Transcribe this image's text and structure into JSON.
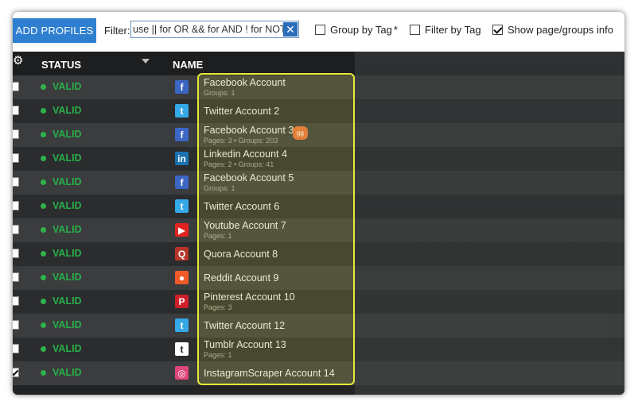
{
  "toolbar": {
    "add_profiles_label": "ADD PROFILES",
    "filter_label": "Filter:",
    "filter_value": "use || for OR && for AND ! for NOT",
    "filter_clear_glyph": "✕",
    "group_by_tag_label": "Group by Tag",
    "group_by_tag_asterisk": "*",
    "group_by_tag_checked": false,
    "filter_by_tag_label": "Filter by Tag",
    "filter_by_tag_checked": false,
    "show_info_label": "Show page/groups info",
    "show_info_checked": true
  },
  "table": {
    "gear_glyph": "⚙",
    "header_status": "STATUS",
    "header_name": "NAME",
    "rows": [
      {
        "status": "VALID",
        "icon": "facebook-icon",
        "icon_glyph": "f",
        "icon_color": "#3b66c4",
        "name": "Facebook Account",
        "sub": "Groups: 1",
        "checked": false
      },
      {
        "status": "VALID",
        "icon": "twitter-icon",
        "icon_glyph": "t",
        "icon_color": "#35a8e8",
        "name": "Twitter Account 2",
        "sub": "",
        "checked": false
      },
      {
        "status": "VALID",
        "icon": "facebook-icon",
        "icon_glyph": "f",
        "icon_color": "#3b66c4",
        "name": "Facebook Account 3",
        "sub": "Pages: 3 • Groups: 203",
        "badge": "gg",
        "checked": false
      },
      {
        "status": "VALID",
        "icon": "linkedin-icon",
        "icon_glyph": "in",
        "icon_color": "#1a73b1",
        "name": "Linkedin Account 4",
        "sub": "Pages: 2 • Groups: 41",
        "checked": false
      },
      {
        "status": "VALID",
        "icon": "facebook-icon",
        "icon_glyph": "f",
        "icon_color": "#3b66c4",
        "name": "Facebook Account 5",
        "sub": "Groups: 1",
        "checked": false
      },
      {
        "status": "VALID",
        "icon": "twitter-icon",
        "icon_glyph": "t",
        "icon_color": "#35a8e8",
        "name": "Twitter Account  6",
        "sub": "",
        "checked": false
      },
      {
        "status": "VALID",
        "icon": "youtube-icon",
        "icon_glyph": "▶",
        "icon_color": "#e32222",
        "name": "Youtube Account 7",
        "sub": "Pages: 1",
        "checked": false
      },
      {
        "status": "VALID",
        "icon": "quora-icon",
        "icon_glyph": "Q",
        "icon_color": "#b8352b",
        "name": "Quora Account 8",
        "sub": "",
        "checked": false
      },
      {
        "status": "VALID",
        "icon": "reddit-icon",
        "icon_glyph": "●",
        "icon_color": "#f05a28",
        "name": "Reddit Account 9",
        "sub": "",
        "checked": false
      },
      {
        "status": "VALID",
        "icon": "pinterest-icon",
        "icon_glyph": "P",
        "icon_color": "#d01f2a",
        "name": "Pinterest Account 10",
        "sub": "Pages: 3",
        "checked": false
      },
      {
        "status": "VALID",
        "icon": "twitter-icon",
        "icon_glyph": "t",
        "icon_color": "#35a8e8",
        "name": "Twitter Account 12",
        "sub": "",
        "checked": false
      },
      {
        "status": "VALID",
        "icon": "tumblr-icon",
        "icon_glyph": "t",
        "icon_color": "#ffffff",
        "name": "Tumblr Account 13",
        "sub": "Pages: 1",
        "checked": false
      },
      {
        "status": "VALID",
        "icon": "instagram-icon",
        "icon_glyph": "◎",
        "icon_color": "#e0457b",
        "name": "InstagramScraper Account 14",
        "sub": "",
        "checked": true
      }
    ]
  }
}
